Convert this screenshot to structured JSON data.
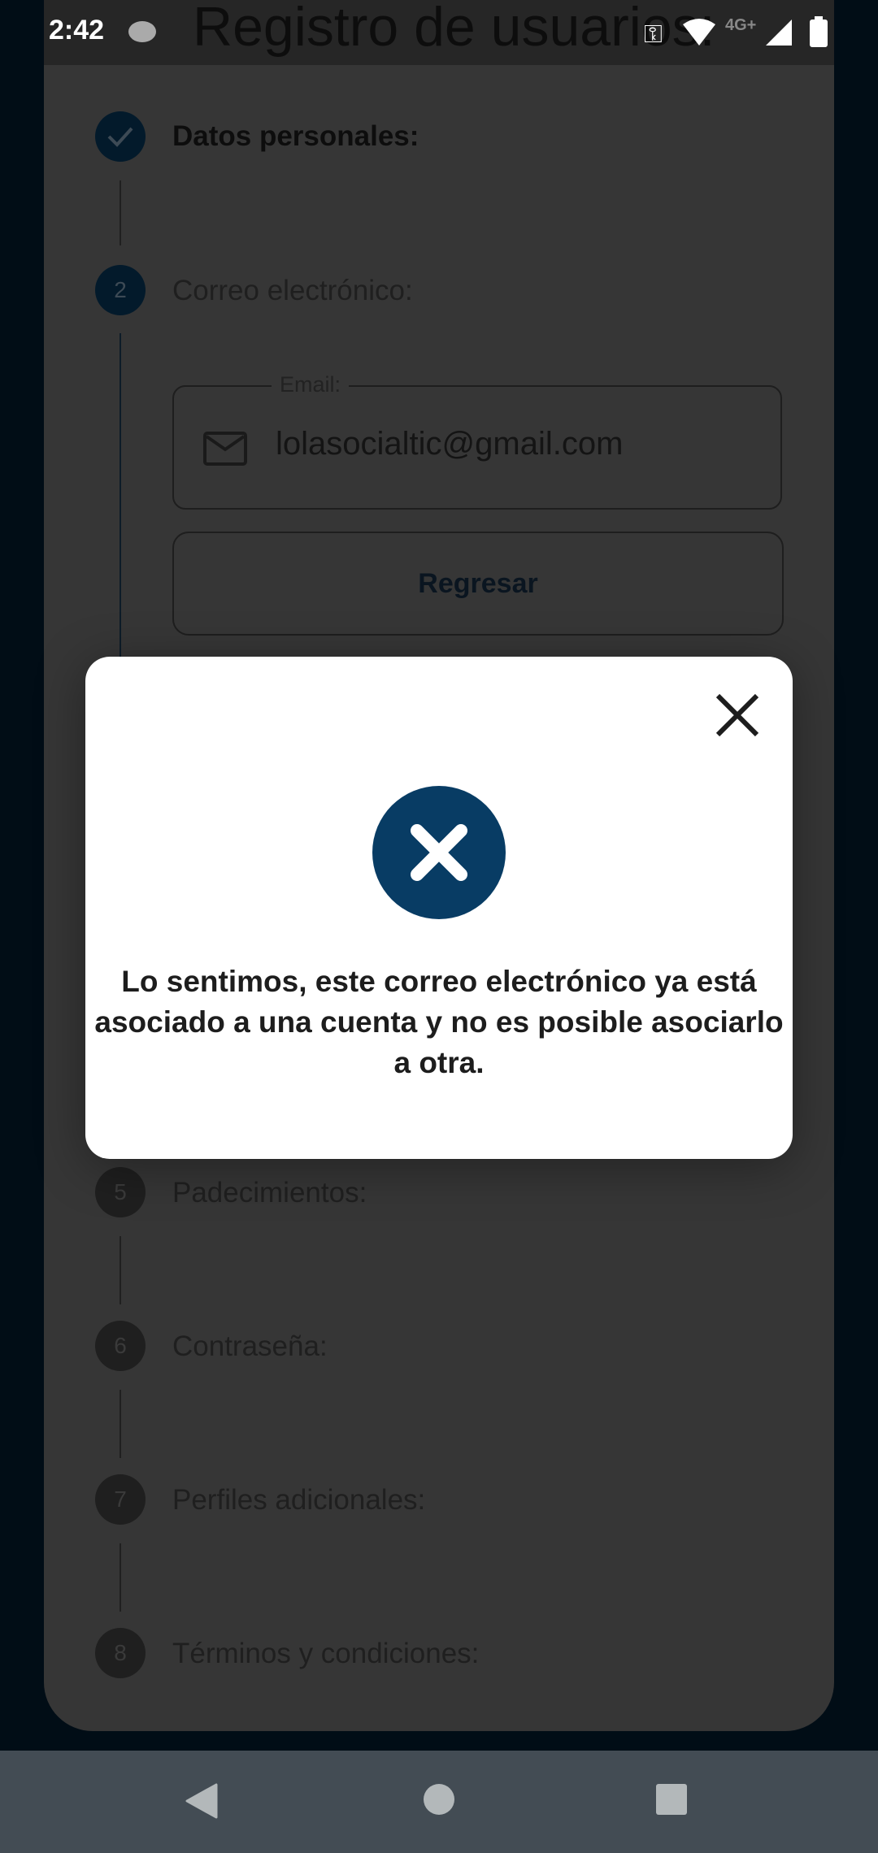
{
  "status_bar": {
    "time": "2:42",
    "network": "4G+"
  },
  "header": {
    "title": "Registro de usuarios:"
  },
  "steps": [
    {
      "number": "1",
      "label": "Datos personales:",
      "state": "completed"
    },
    {
      "number": "2",
      "label": "Correo electrónico:",
      "state": "active"
    },
    {
      "number": "5",
      "label": "Padecimientos:"
    },
    {
      "number": "6",
      "label": "Contraseña:"
    },
    {
      "number": "7",
      "label": "Perfiles adicionales:"
    },
    {
      "number": "8",
      "label": "Términos y condiciones:"
    }
  ],
  "email": {
    "label": "Email:",
    "value": "lolasocialtic@gmail.com"
  },
  "back_button": "Regresar",
  "dialog": {
    "message": "Lo sentimos, este correo electrónico ya está asociado a una cuenta y no es posible asociarlo a otra.",
    "icon": "error-x-circle",
    "accent": "#083c64"
  }
}
